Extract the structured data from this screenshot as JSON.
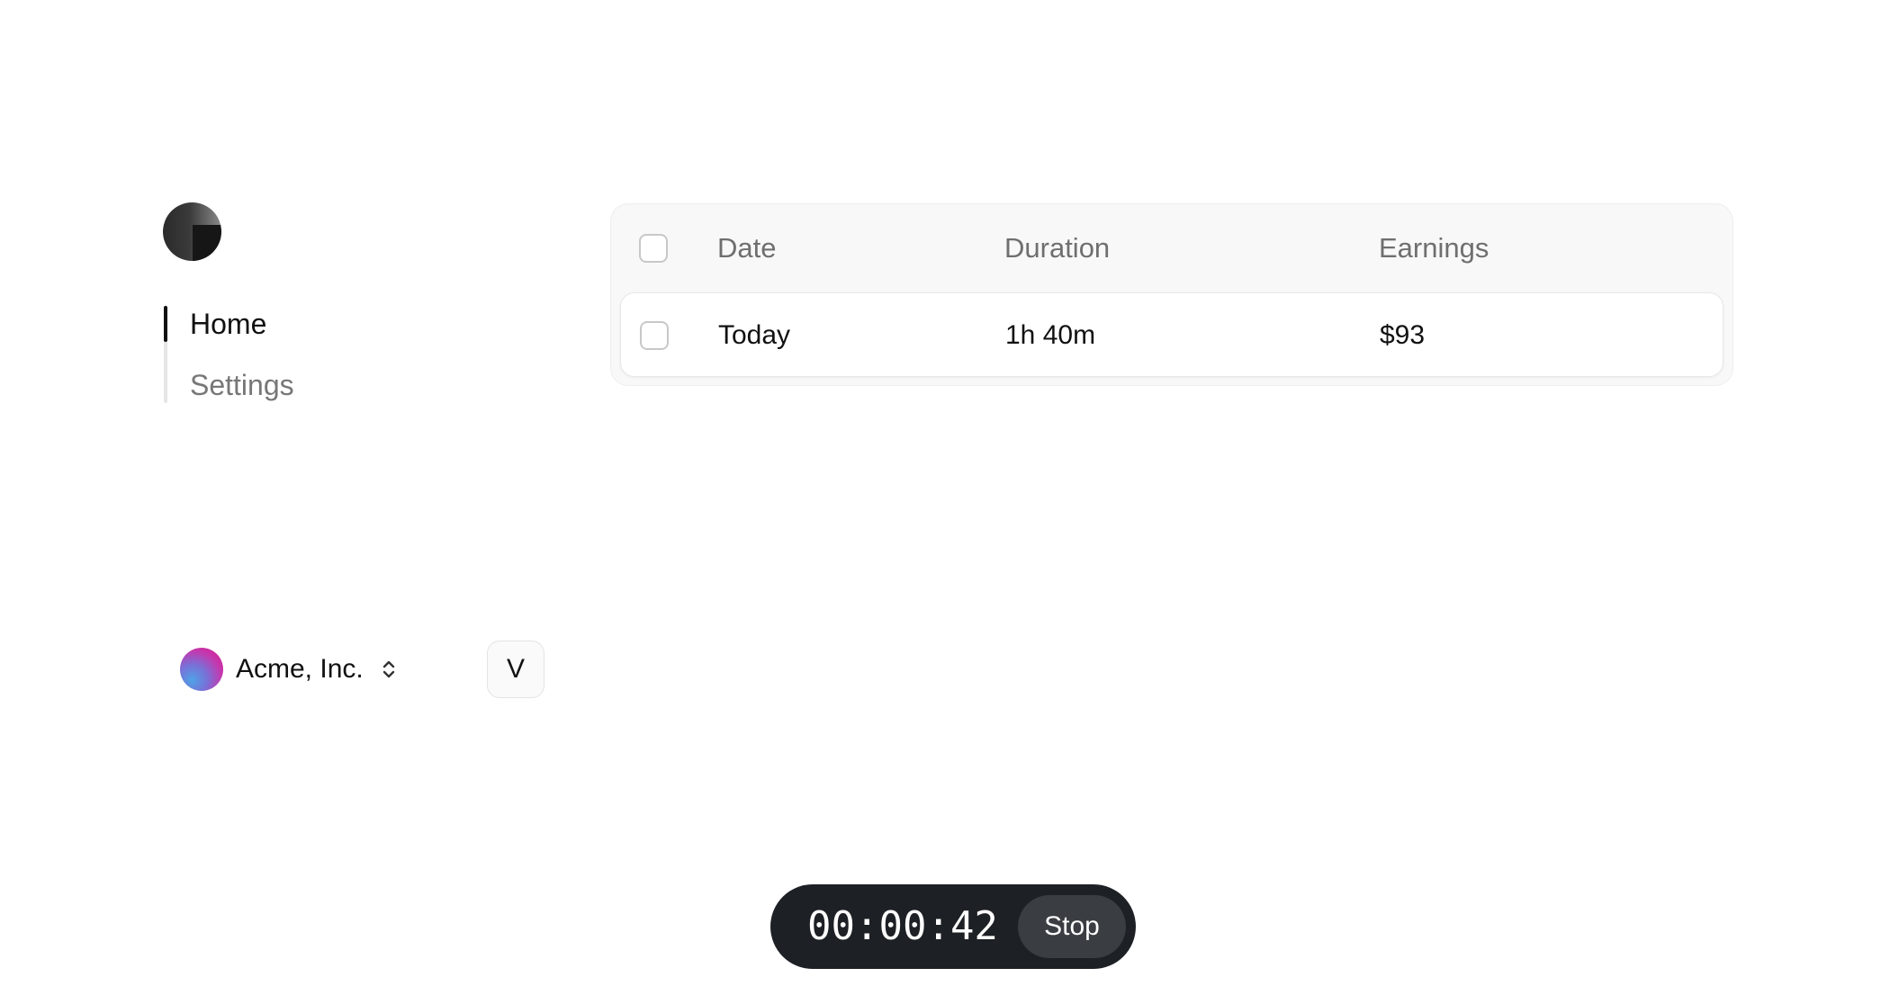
{
  "sidebar": {
    "logo_icon": "app-logo-icon",
    "nav": [
      {
        "label": "Home",
        "active": true
      },
      {
        "label": "Settings",
        "active": false
      }
    ],
    "workspace": {
      "name": "Acme, Inc.",
      "icon": "chevron-up-down-icon"
    },
    "user": {
      "initial": "V"
    }
  },
  "table": {
    "columns": [
      "Date",
      "Duration",
      "Earnings"
    ],
    "rows": [
      {
        "date": "Today",
        "duration": "1h 40m",
        "earnings": "$93",
        "checked": false
      }
    ]
  },
  "timer": {
    "elapsed": "00:00:42",
    "stop_label": "Stop"
  },
  "colors": {
    "timer_bg": "#1d2024",
    "stop_bg": "#3a3d42",
    "active_nav": "#111111",
    "inactive_nav": "#777777",
    "header_text": "#6f6f6f"
  }
}
